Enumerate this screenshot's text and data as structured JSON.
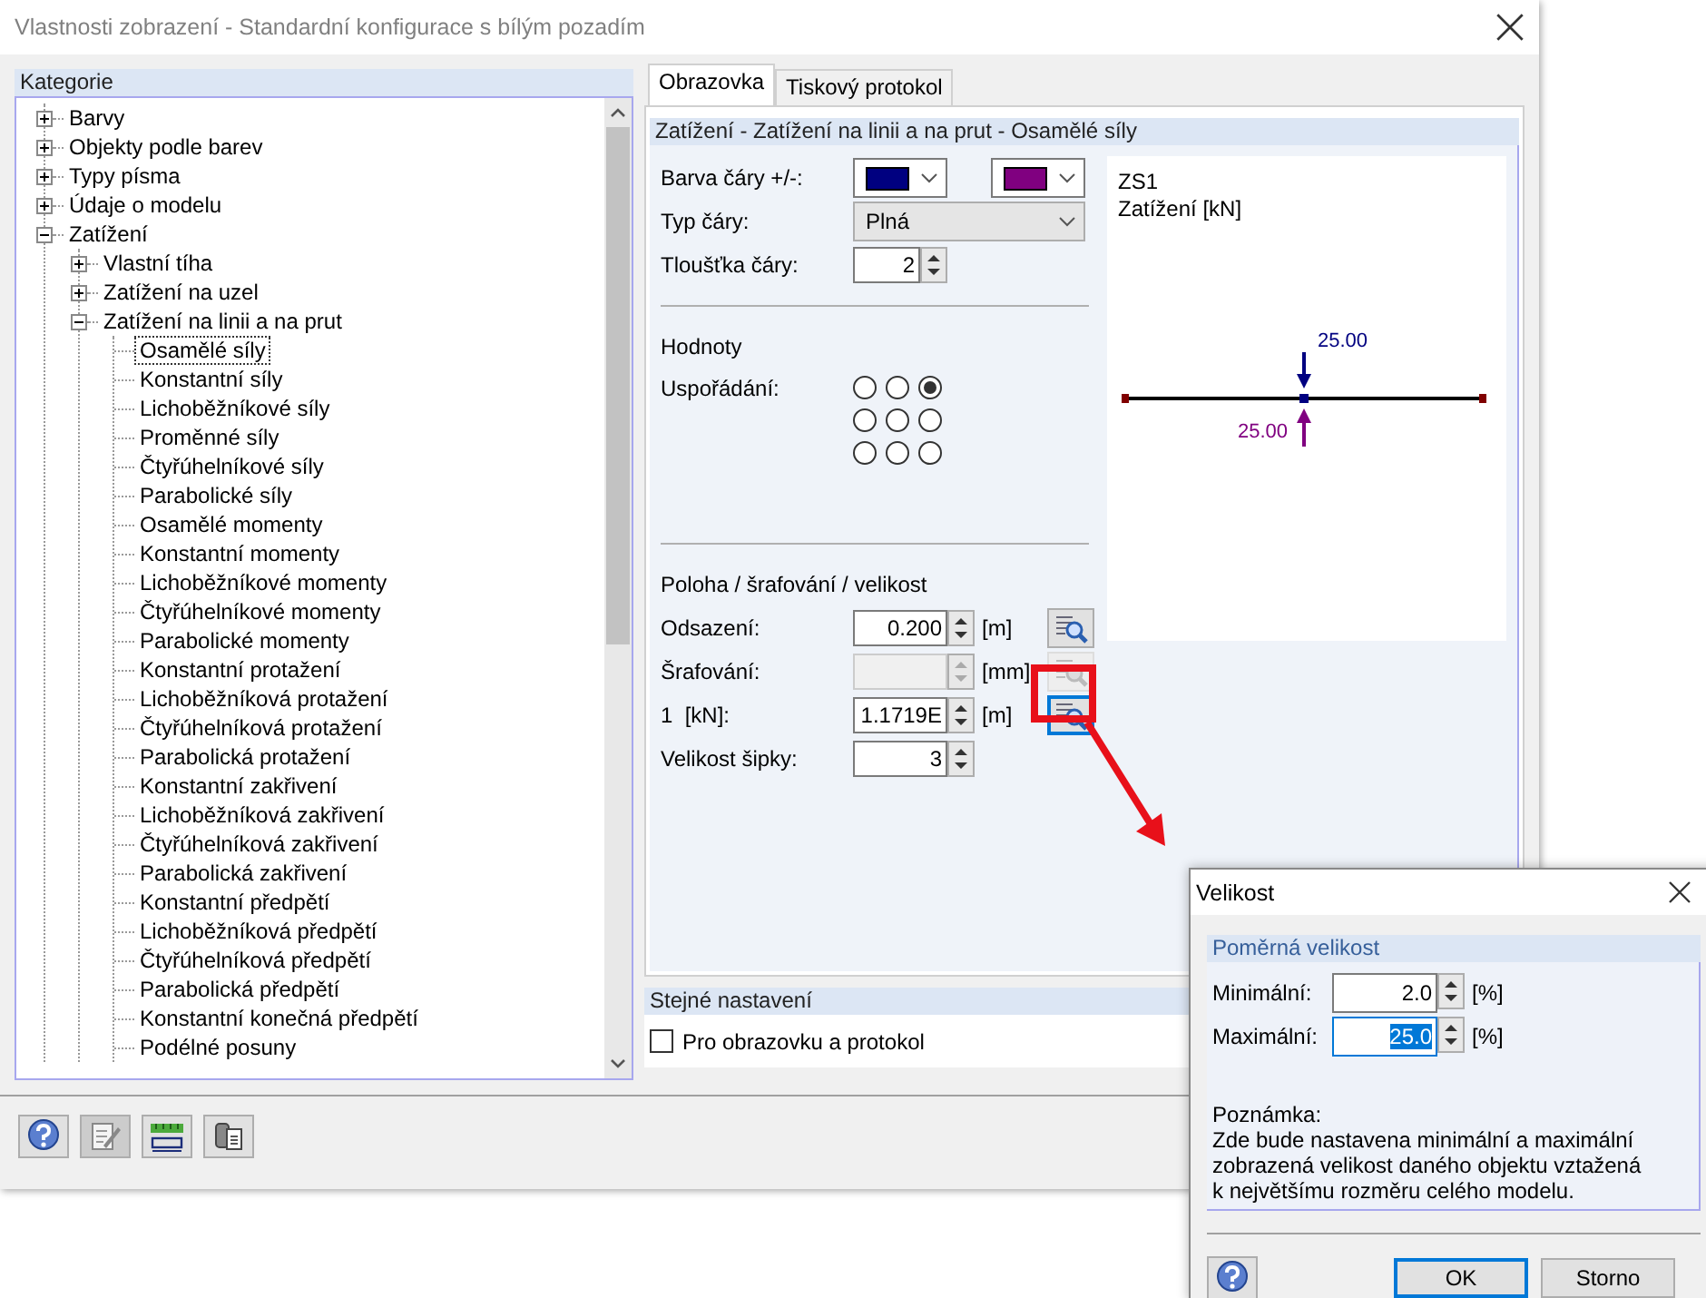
{
  "window": {
    "title": "Vlastnosti zobrazení - Standardní konfigurace s bílým pozadím"
  },
  "categories": {
    "title": "Kategorie",
    "tree": [
      {
        "label": "Barvy",
        "expanded": false,
        "selected": false
      },
      {
        "label": "Objekty podle barev",
        "expanded": false,
        "selected": false
      },
      {
        "label": "Typy písma",
        "expanded": false,
        "selected": false
      },
      {
        "label": "Údaje o modelu",
        "expanded": false,
        "selected": false
      },
      {
        "label": "Zatížení",
        "expanded": true,
        "selected": false,
        "children": [
          {
            "label": "Vlastní tíha",
            "expanded": false,
            "selected": false
          },
          {
            "label": "Zatížení na uzel",
            "expanded": false,
            "selected": false
          },
          {
            "label": "Zatížení na linii a na prut",
            "expanded": true,
            "selected": false,
            "children": [
              {
                "label": "Osamělé síly",
                "selected": true
              },
              {
                "label": "Konstantní síly",
                "selected": false
              },
              {
                "label": "Lichoběžníkové síly",
                "selected": false
              },
              {
                "label": "Proměnné síly",
                "selected": false
              },
              {
                "label": "Čtyřúhelníkové síly",
                "selected": false
              },
              {
                "label": "Parabolické síly",
                "selected": false
              },
              {
                "label": "Osamělé momenty",
                "selected": false
              },
              {
                "label": "Konstantní momenty",
                "selected": false
              },
              {
                "label": "Lichoběžníkové momenty",
                "selected": false
              },
              {
                "label": "Čtyřúhelníkové momenty",
                "selected": false
              },
              {
                "label": "Parabolické momenty",
                "selected": false
              },
              {
                "label": "Konstantní protažení",
                "selected": false
              },
              {
                "label": "Lichoběžníková protažení",
                "selected": false
              },
              {
                "label": "Čtyřúhelníková protažení",
                "selected": false
              },
              {
                "label": "Parabolická protažení",
                "selected": false
              },
              {
                "label": "Konstantní zakřivení",
                "selected": false
              },
              {
                "label": "Lichoběžníková zakřivení",
                "selected": false
              },
              {
                "label": "Čtyřúhelníková zakřivení",
                "selected": false
              },
              {
                "label": "Parabolická zakřivení",
                "selected": false
              },
              {
                "label": "Konstantní předpětí",
                "selected": false
              },
              {
                "label": "Lichoběžníková předpětí",
                "selected": false
              },
              {
                "label": "Čtyřúhelníková předpětí",
                "selected": false
              },
              {
                "label": "Parabolická předpětí",
                "selected": false
              },
              {
                "label": "Konstantní konečná předpětí",
                "selected": false
              },
              {
                "label": "Podélné posuny",
                "selected": false
              }
            ]
          }
        ]
      }
    ]
  },
  "tabs": [
    {
      "label": "Obrazovka",
      "selected": true
    },
    {
      "label": "Tiskový protokol",
      "selected": false
    }
  ],
  "panel": {
    "title": "Zatížení - Zatížení na linii a na prut - Osamělé síly",
    "line_color": {
      "label": "Barva čáry +/-:",
      "swatches": [
        {
          "color": "#000080"
        },
        {
          "color": "#800080"
        }
      ]
    },
    "line_type": {
      "label": "Typ čáry:",
      "value": "Plná"
    },
    "line_width": {
      "label": "Tloušťka čáry:",
      "value": "2"
    },
    "values_heading": "Hodnoty",
    "arrangement": {
      "label": "Uspořádání:",
      "options": [
        {
          "selected": false
        },
        {
          "selected": false
        },
        {
          "selected": true
        },
        {
          "selected": false
        },
        {
          "selected": false
        },
        {
          "selected": false
        },
        {
          "selected": false
        },
        {
          "selected": false
        },
        {
          "selected": false
        }
      ]
    },
    "position_heading": "Poloha / šrafování / velikost",
    "size_rows": [
      {
        "label": "Odsazení:",
        "value": "0.200",
        "unit": "[m]",
        "disabled": false,
        "focused": false
      },
      {
        "label": "Šrafování:",
        "unit": "[mm]",
        "disabled": true,
        "focused": false
      },
      {
        "label": "1  [kN]:",
        "value": "1.1719E",
        "unit": "[m]",
        "disabled": false,
        "focused": true
      }
    ],
    "arrow_size": {
      "label": "Velikost šipky:",
      "value": "3"
    },
    "preview": {
      "load_case": "ZS1",
      "quantity": "Zatížení [kN]",
      "labels": [
        {
          "text": "25.00",
          "color": "#000080"
        },
        {
          "text": "25.00",
          "color": "#800080"
        }
      ]
    }
  },
  "same_settings": {
    "title": "Stejné nastavení",
    "checkbox": {
      "label": "Pro obrazovku a protokol",
      "checked": false
    }
  },
  "footer_buttons": [
    {
      "kind": "help",
      "pressed": false
    },
    {
      "kind": "edit",
      "pressed": true
    },
    {
      "kind": "units",
      "pressed": false
    },
    {
      "kind": "export",
      "pressed": false
    }
  ],
  "size_dialog": {
    "title": "Velikost",
    "group": "Poměrná velikost",
    "fields": [
      {
        "label": "Minimální:",
        "value": "2.0",
        "unit": "[%]",
        "selected": false
      },
      {
        "label": "Maximální:",
        "value": "25.0",
        "unit": "[%]",
        "selected": true
      }
    ],
    "note_title": "Poznámka:",
    "note": "Zde bude nastavena minimální a maximální zobrazená velikost daného objektu vztažená k největšímu rozměru celého modelu.",
    "buttons": [
      {
        "label": "OK",
        "default": true
      },
      {
        "label": "Storno",
        "default": false
      }
    ]
  }
}
